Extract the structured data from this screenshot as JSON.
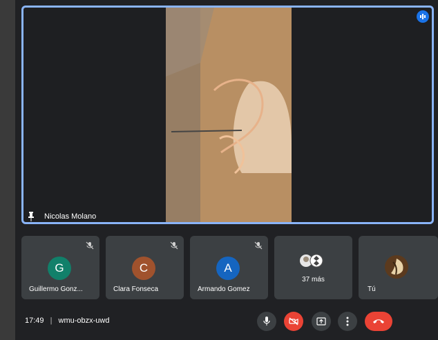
{
  "participant_main": "Nicolas Molano",
  "participants": [
    {
      "name": "Guillermo Gonz...",
      "initial": "G",
      "color": "#11806a"
    },
    {
      "name": "Clara Fonseca",
      "initial": "C",
      "color": "#a0522d"
    },
    {
      "name": "Armando Gomez",
      "initial": "A",
      "color": "#1565c0"
    }
  ],
  "more_label": "37 más",
  "self_label": "Tú",
  "time": "17:49",
  "separator": "|",
  "meeting_code": "wmu-obzx-uwd",
  "icons": {
    "speaking": "audio-active-icon",
    "pin": "pin-icon",
    "mute": "mic-off-icon",
    "mic": "mic-icon",
    "camera": "camera-off-icon",
    "present": "present-icon",
    "more": "more-options-icon",
    "end": "end-call-icon"
  }
}
